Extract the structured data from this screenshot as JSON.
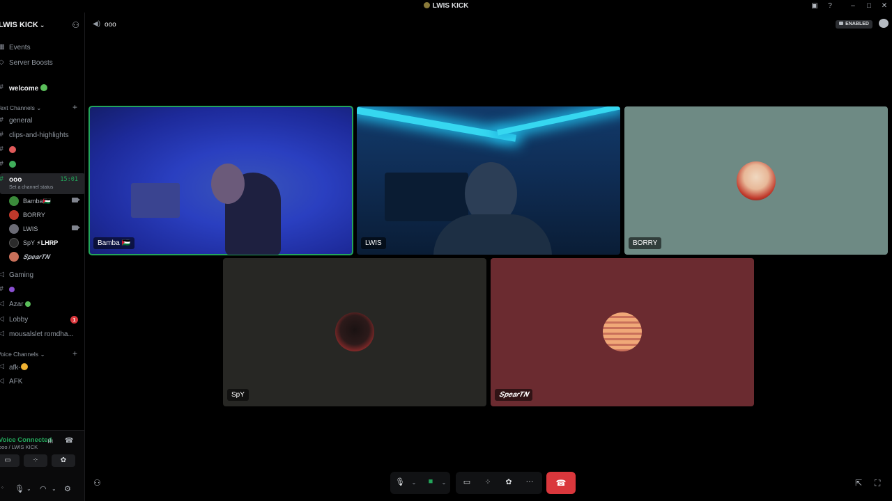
{
  "titlebar": {
    "title": "LWIS KICK",
    "buttons": [
      "inbox-icon",
      "help-icon",
      "minimize-icon",
      "maximize-icon",
      "close-icon"
    ]
  },
  "sidebar": {
    "server_name": "LWIS KICK",
    "top_items": [
      {
        "label": "Events",
        "icon": "calendar-icon"
      },
      {
        "label": "Server Boosts",
        "icon": "boost-icon"
      }
    ],
    "welcome": {
      "label": "welcome",
      "emoji": "green-alien"
    },
    "text_category": "Text Channels",
    "text_channels": [
      {
        "label": "general"
      },
      {
        "label": "clips-and-highlights"
      },
      {
        "label": "",
        "emoji": "red-face"
      },
      {
        "label": "",
        "emoji": "green-orb"
      }
    ],
    "active_voice": {
      "label": "ooo",
      "time": "15:01",
      "status_hint": "Set a channel status"
    },
    "members": [
      {
        "name": "Bamba",
        "suffix": "🇵🇸",
        "camera": true,
        "color": "#3a8a3a"
      },
      {
        "name": "BORRY",
        "camera": false,
        "color": "#c0392b"
      },
      {
        "name": "LWIS",
        "camera": true,
        "color": "#6b6b75"
      },
      {
        "name": "SpY",
        "suffix": "⚡LHRP",
        "camera": false,
        "color": "#2b2b2b"
      },
      {
        "name": "𝑺𝒑𝒆𝒂𝒓𝑻𝑵",
        "camera": false,
        "color": "#c9705a"
      }
    ],
    "other_voice": [
      {
        "label": "Gaming"
      },
      {
        "label": "",
        "emoji": "purple"
      },
      {
        "label": "Azar",
        "emoji": "green"
      },
      {
        "label": "Lobby",
        "badge": "1"
      },
      {
        "label": "mousalslet romdha..."
      }
    ],
    "voice_category": "Voice Channels",
    "voice_channels": [
      {
        "label": "afk-",
        "emoji": "smile"
      },
      {
        "label": "AFK"
      }
    ]
  },
  "voice_panel": {
    "status": "Voice Connected",
    "server": "ooo / LWIS KICK"
  },
  "header": {
    "channel": "ooo",
    "enabled_label": "ENABLED"
  },
  "tiles": [
    {
      "label": "Bamba 🇵🇸",
      "speaking": true
    },
    {
      "label": "LWIS"
    },
    {
      "label": "BORRY"
    },
    {
      "label": "SpY"
    },
    {
      "label": "𝑺𝒑𝒆𝒂𝒓𝑻𝑵"
    }
  ],
  "colors": {
    "connected": "#23a55a",
    "hangup": "#da373c",
    "borry_bg": "#6e8a84",
    "spy_bg": "#272724",
    "spear_bg": "#6b2b30"
  }
}
